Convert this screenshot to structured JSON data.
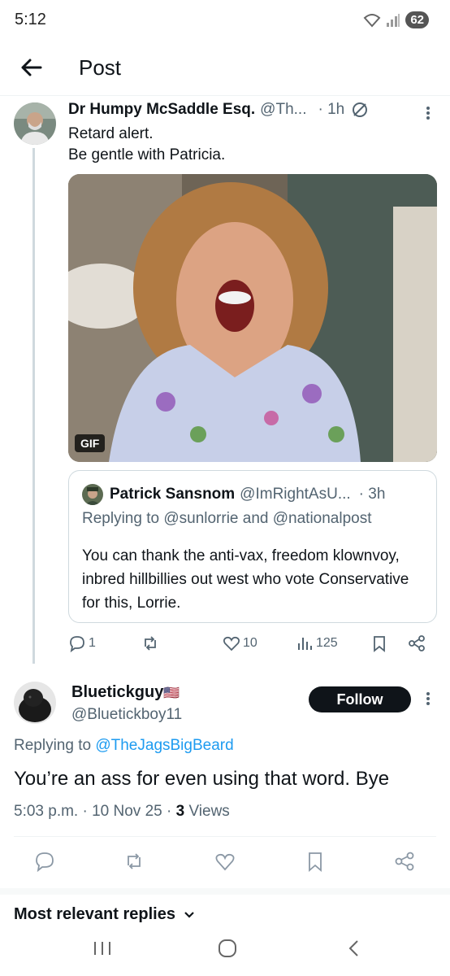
{
  "status_bar": {
    "time": "5:12",
    "battery": "62"
  },
  "header": {
    "title": "Post"
  },
  "tweet": {
    "name": "Dr Humpy McSaddle Esq.",
    "handle": "@Th...",
    "time": "· 1h",
    "line1": "Retard alert.",
    "line2": "Be gentle with Patricia.",
    "gif_badge": "GIF"
  },
  "quote": {
    "name": "Patrick Sansnom",
    "handle": "@ImRightAsU...",
    "time": "· 3h",
    "replying": "Replying to @sunlorrie and @nationalpost",
    "text": "You can thank the anti-vax, freedom klownvoy, inbred hillbillies out west who vote Conservative for this, Lorrie."
  },
  "actions": {
    "replies": "1",
    "retweets": "",
    "likes": "10",
    "views": "125"
  },
  "reply": {
    "name": "Bluetickguy",
    "flag": "🇺🇸",
    "handle": "@Bluetickboy11",
    "follow_label": "Follow",
    "replying_prefix": "Replying to ",
    "replying_handle": "@TheJagsBigBeard",
    "text": "You’re an ass for even using that word. Bye",
    "meta_time": "5:03 p.m. · 10 Nov 25 · ",
    "meta_views_count": "3",
    "meta_views_label": " Views"
  },
  "sort": {
    "label": "Most relevant replies"
  },
  "colors": {
    "accent": "#1d9bf0",
    "text": "#0f1419",
    "muted": "#536471",
    "border": "#cfd9de"
  }
}
